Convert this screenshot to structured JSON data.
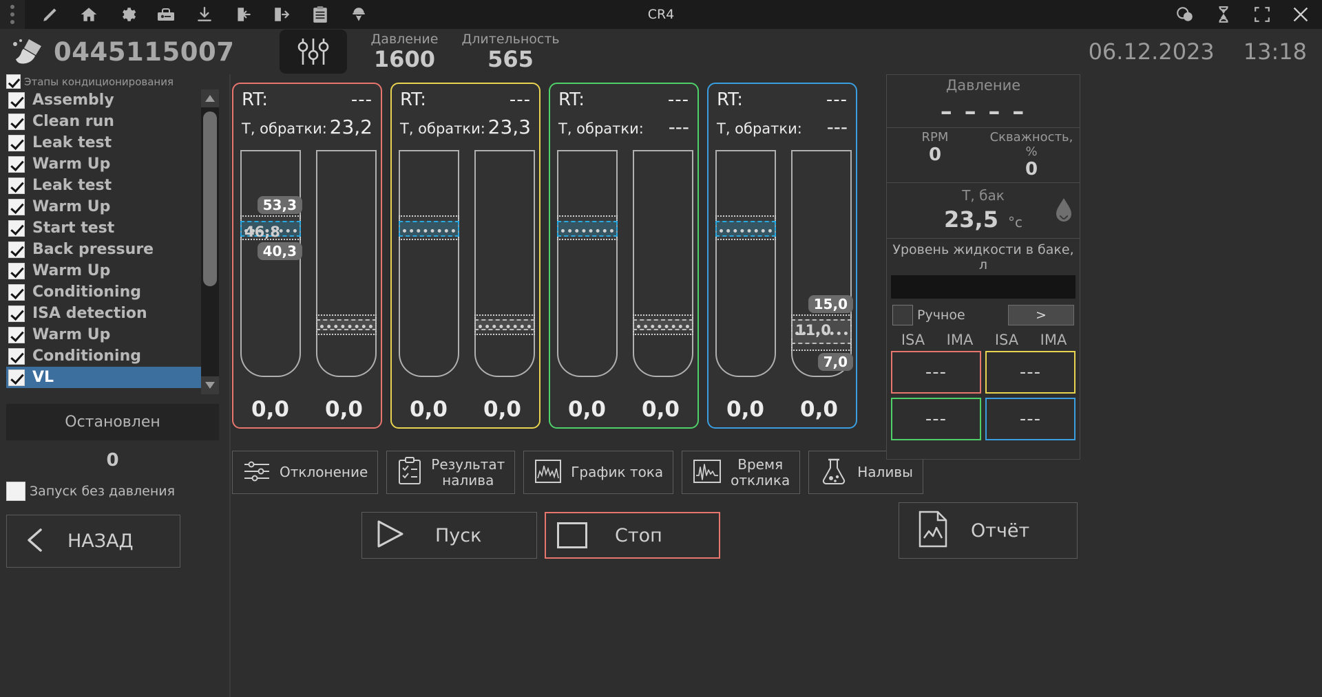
{
  "titlebar": {
    "title": "CR4",
    "icons": [
      "grip-icon",
      "pencil-icon",
      "home-icon",
      "gear-icon",
      "toolbox-icon",
      "download-icon",
      "import-icon",
      "export-icon",
      "clipboard-icon",
      "worker-icon"
    ],
    "right_icons": [
      "chat-icon",
      "hourglass-icon",
      "fullscreen-icon",
      "close-icon"
    ]
  },
  "header": {
    "brush_icon": "brush-icon",
    "serial": "0445115007",
    "sliders_icon": "sliders-icon",
    "pressure_label": "Давление",
    "pressure_value": "1600",
    "duration_label": "Длительность",
    "duration_value": "565",
    "date": "06.12.2023",
    "time": "13:18"
  },
  "sidebar": {
    "stages_header": "Этапы кондиционирования",
    "stages": [
      {
        "label": "Assembly",
        "checked": true,
        "selected": false
      },
      {
        "label": "Clean run",
        "checked": true,
        "selected": false
      },
      {
        "label": "Leak test",
        "checked": true,
        "selected": false
      },
      {
        "label": "Warm Up",
        "checked": true,
        "selected": false
      },
      {
        "label": "Leak test",
        "checked": true,
        "selected": false
      },
      {
        "label": "Warm Up",
        "checked": true,
        "selected": false
      },
      {
        "label": "Start test",
        "checked": true,
        "selected": false
      },
      {
        "label": "Back pressure",
        "checked": true,
        "selected": false
      },
      {
        "label": "Warm Up",
        "checked": true,
        "selected": false
      },
      {
        "label": "Conditioning",
        "checked": true,
        "selected": false
      },
      {
        "label": "ISA detection",
        "checked": true,
        "selected": false
      },
      {
        "label": "Warm Up",
        "checked": true,
        "selected": false
      },
      {
        "label": "Conditioning",
        "checked": true,
        "selected": false
      },
      {
        "label": "VL",
        "checked": true,
        "selected": true
      }
    ],
    "status": "Остановлен",
    "counter": "0",
    "nopressure_label": "Запуск без давления",
    "nopressure_checked": false,
    "back_button": "НАЗАД"
  },
  "channels": {
    "rt_label": "RT:",
    "return_label": "Т, обратки:",
    "list": [
      {
        "color": "#e8766f",
        "rt": "---",
        "return_temp": "23,2",
        "tubes": [
          {
            "high": "53,3",
            "target": "46,8",
            "low": "40,3",
            "bottom": "0,0",
            "band_top_pct": 29,
            "band_height_pct": 11,
            "target_top_pct": 31.5,
            "target_height_pct": 7,
            "target_color": "blue"
          },
          {
            "high": "",
            "target": "",
            "low": "",
            "bottom": "0,0",
            "band_top_pct": 73,
            "band_height_pct": 9,
            "target_top_pct": 75,
            "target_height_pct": 5,
            "target_color": "gray"
          }
        ]
      },
      {
        "color": "#e8d44f",
        "rt": "---",
        "return_temp": "23,3",
        "tubes": [
          {
            "high": "",
            "target": "",
            "low": "",
            "bottom": "0,0",
            "band_top_pct": 29,
            "band_height_pct": 11,
            "target_top_pct": 31.5,
            "target_height_pct": 7,
            "target_color": "blue"
          },
          {
            "high": "",
            "target": "",
            "low": "",
            "bottom": "0,0",
            "band_top_pct": 73,
            "band_height_pct": 9,
            "target_top_pct": 75,
            "target_height_pct": 5,
            "target_color": "gray"
          }
        ]
      },
      {
        "color": "#4fd16a",
        "rt": "---",
        "return_temp": "---",
        "tubes": [
          {
            "high": "",
            "target": "",
            "low": "",
            "bottom": "0,0",
            "band_top_pct": 29,
            "band_height_pct": 11,
            "target_top_pct": 31.5,
            "target_height_pct": 7,
            "target_color": "blue"
          },
          {
            "high": "",
            "target": "",
            "low": "",
            "bottom": "0,0",
            "band_top_pct": 73,
            "band_height_pct": 9,
            "target_top_pct": 75,
            "target_height_pct": 5,
            "target_color": "gray"
          }
        ]
      },
      {
        "color": "#3b9ee0",
        "rt": "---",
        "return_temp": "---",
        "tubes": [
          {
            "high": "",
            "target": "",
            "low": "",
            "bottom": "0,0",
            "band_top_pct": 29,
            "band_height_pct": 11,
            "target_top_pct": 31.5,
            "target_height_pct": 7,
            "target_color": "blue"
          },
          {
            "high": "15,0",
            "target": "11,0",
            "low": "7,0",
            "bottom": "0,0",
            "band_top_pct": 73,
            "band_height_pct": 16,
            "target_top_pct": 75,
            "target_height_pct": 11,
            "target_color": "gray"
          }
        ]
      }
    ]
  },
  "function_buttons": [
    {
      "icon": "deviation-icon",
      "label": "Отклонение"
    },
    {
      "icon": "checklist-icon",
      "label": "Результат\nналива"
    },
    {
      "icon": "current-graph-icon",
      "label": "График тока"
    },
    {
      "icon": "waveform-icon",
      "label": "Время\nотклика"
    },
    {
      "icon": "flask-icon",
      "label": "Наливы"
    }
  ],
  "main_buttons": {
    "start": "Пуск",
    "stop": "Стоп",
    "report": "Отчёт"
  },
  "right_panel": {
    "pressure_title": "Давление",
    "pressure_value": "– – – –",
    "rpm_label": "RPM",
    "rpm_value": "0",
    "duty_label": "Скважность, %",
    "duty_value": "0",
    "tank_label": "Т, бак",
    "tank_value": "23,5",
    "tank_unit": "°с",
    "level_label": "Уровень жидкости в баке, л",
    "manual_label": "Ручное",
    "manual_checked": false,
    "arrow_label": ">",
    "columns": [
      "ISA",
      "IMA",
      "ISA",
      "IMA"
    ],
    "cells": [
      {
        "value": "---",
        "color": "#e8766f"
      },
      {
        "value": "---",
        "color": "#e8d44f"
      },
      {
        "value": "---",
        "color": "#4fd16a"
      },
      {
        "value": "---",
        "color": "#3b9ee0"
      }
    ]
  }
}
